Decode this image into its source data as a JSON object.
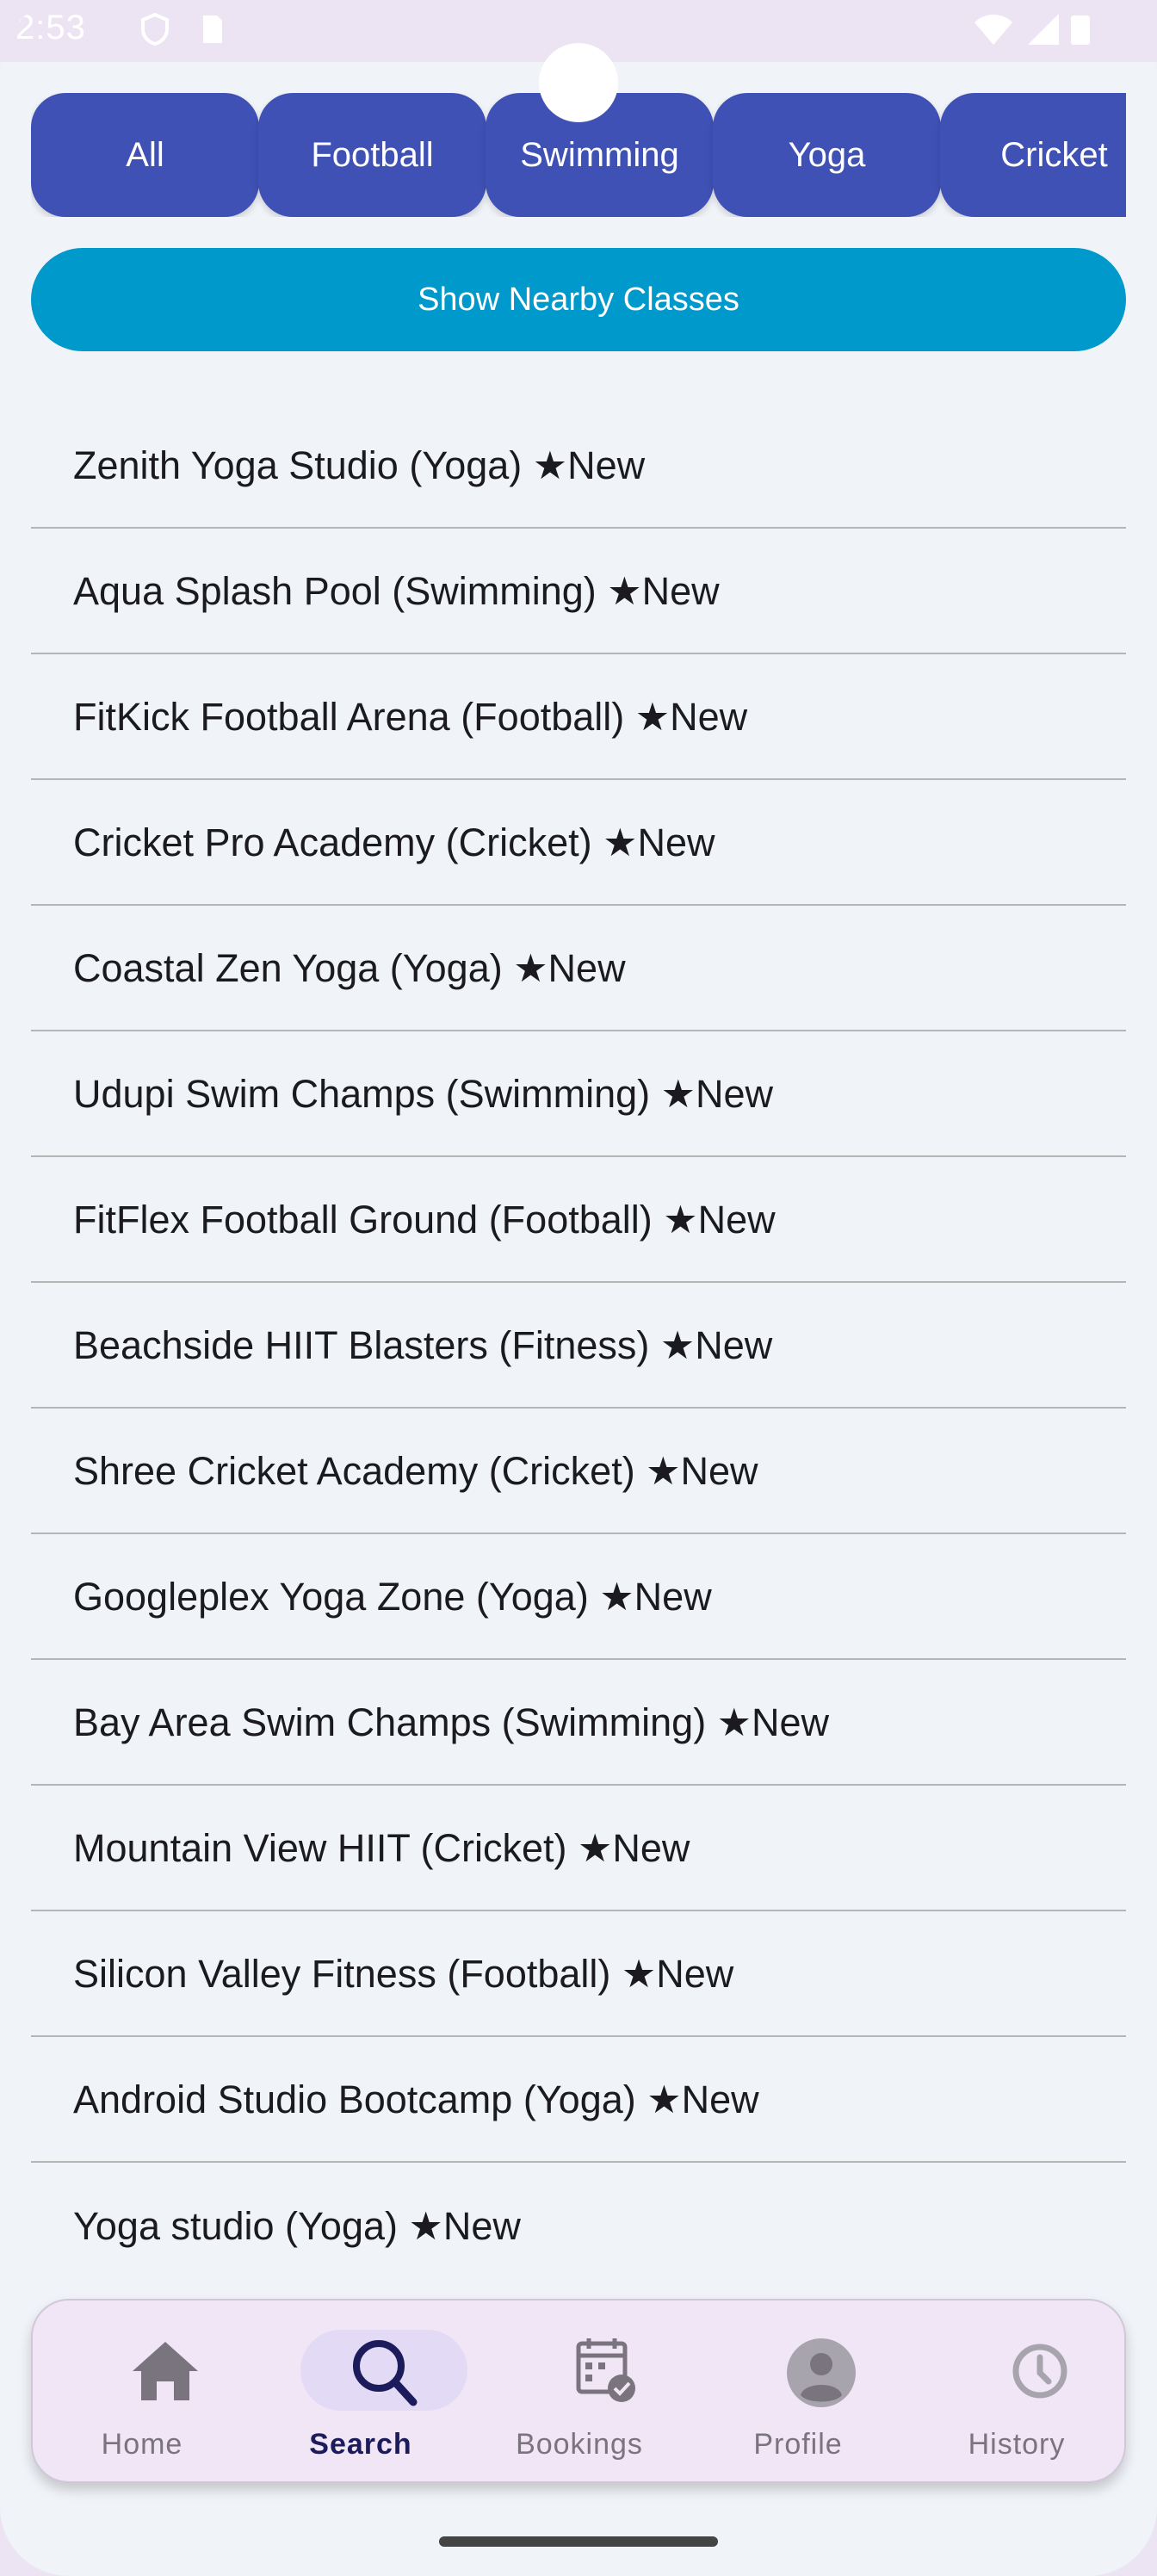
{
  "status_bar": {
    "time": "2:53"
  },
  "filters": {
    "chips": [
      "All",
      "Football",
      "Swimming",
      "Yoga",
      "Cricket"
    ]
  },
  "nearby_button": "Show Nearby Classes",
  "classes": [
    "Zenith Yoga Studio (Yoga) ★New",
    "Aqua Splash Pool (Swimming) ★New",
    "FitKick Football Arena (Football) ★New",
    "Cricket Pro Academy (Cricket) ★New",
    "Coastal Zen Yoga (Yoga) ★New",
    "Udupi Swim Champs (Swimming) ★New",
    "FitFlex Football Ground (Football) ★New",
    "Beachside HIIT Blasters (Fitness) ★New",
    "Shree Cricket Academy (Cricket) ★New",
    "Googleplex Yoga Zone (Yoga) ★New",
    "Bay Area Swim Champs (Swimming) ★New",
    "Mountain View HIIT (Cricket) ★New",
    "Silicon Valley Fitness (Football) ★New",
    "Android Studio Bootcamp (Yoga) ★New",
    "Yoga studio (Yoga) ★New"
  ],
  "nav": {
    "items": [
      {
        "label": "Home",
        "icon": "home-icon"
      },
      {
        "label": "Search",
        "icon": "search-icon",
        "active": true
      },
      {
        "label": "Bookings",
        "icon": "calendar-check-icon"
      },
      {
        "label": "Profile",
        "icon": "account-icon"
      },
      {
        "label": "History",
        "icon": "history-icon"
      }
    ]
  },
  "colors": {
    "chip": "#3f51b5",
    "nearby_button": "#0099cc",
    "nav_active": "#1c1b5c",
    "nav_inactive": "#79747e"
  }
}
